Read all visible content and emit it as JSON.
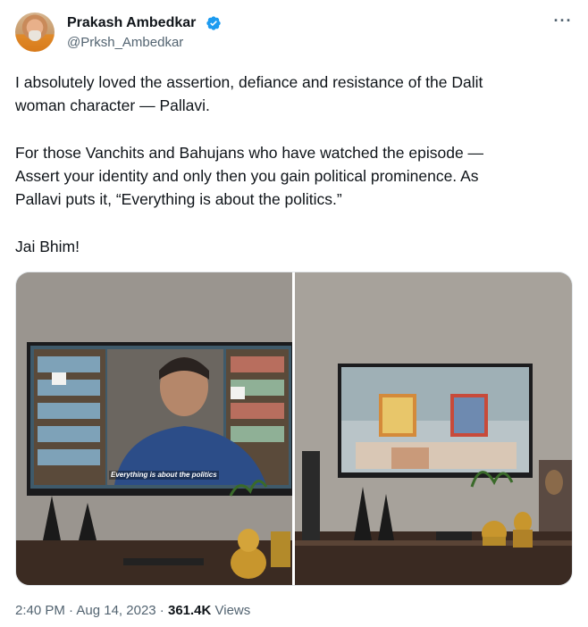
{
  "author": {
    "name": "Prakash Ambedkar",
    "handle": "@Prksh_Ambedkar",
    "verified_icon": "verified-badge-icon",
    "verified_color": "#1d9bf0"
  },
  "more_label": "···",
  "tweet": {
    "line1": "I absolutely loved the assertion, defiance and resistance of the Dalit",
    "line2": "woman character — Pallavi.",
    "line3": "For those Vanchits and Bahujans who have watched the episode —",
    "line4": "Assert your identity and only then you gain political prominence. As",
    "line5": "Pallavi puts it, “Everything is about the politics.”",
    "line6": "Jai Bhim!"
  },
  "media": {
    "subtitle_text": "Everything is about the politics"
  },
  "meta": {
    "time": "2:40 PM",
    "separator": " · ",
    "date": "Aug 14, 2023",
    "views_count": "361.4K",
    "views_label": " Views"
  }
}
